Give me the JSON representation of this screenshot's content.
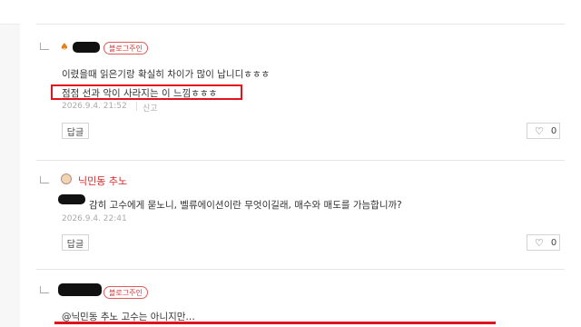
{
  "top": {
    "reply_label": "답글"
  },
  "comments": [
    {
      "badge": "블로그주인",
      "lines": [
        "이렸을때 읽은기랑 확실히 차이가 많이 납니디ㅎㅎㅎ",
        "점점 선과 악이 사라지는 이 느낌ㅎㅎㅎ"
      ],
      "date": "2026.9.4. 21:52",
      "report": "신고",
      "reply": "답글",
      "likes": "0"
    },
    {
      "author": "닉민동 추노",
      "lines": [
        "감히 고수에게 묻노니, 벨류에이션이란 무엇이길래, 매수와 매도를 가늠합니까?"
      ],
      "date": "2026.9.4. 22:41",
      "reply": "답글",
      "likes": "0"
    },
    {
      "badge": "블로그주인",
      "lines": [
        "@닉민동 추노 고수는 아니지만…"
      ]
    }
  ],
  "colors": {
    "highlight": "#e0141e",
    "badge": "#d33333",
    "author_red": "#d12727"
  }
}
